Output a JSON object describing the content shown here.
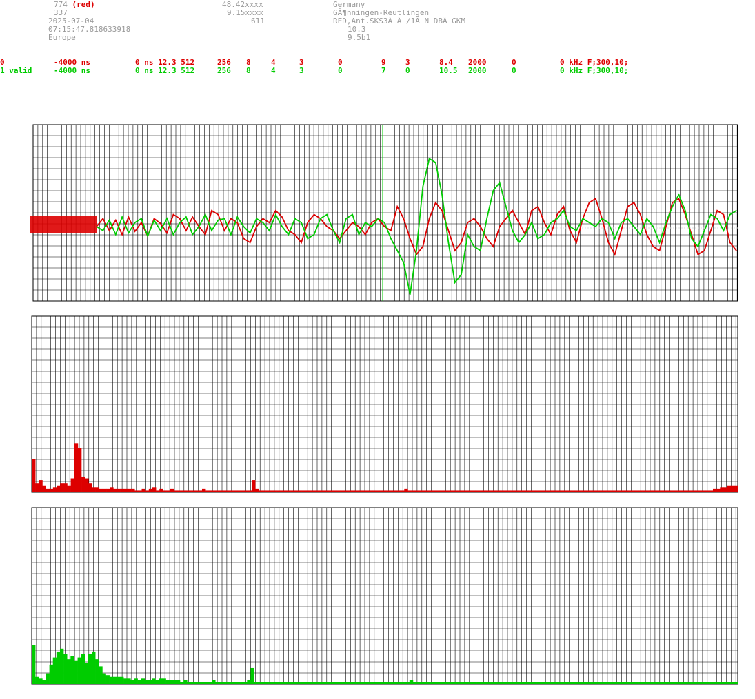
{
  "header": {
    "col1": [
      "774",
      "337",
      "2025-07-04",
      "07:15:47.818633918",
      "Europe"
    ],
    "col1_red_suffix": "(red)",
    "col2": [
      "48.42xxxx",
      "9.15xxxx",
      "611"
    ],
    "col3": [
      "Germany",
      "GÃ¶nningen-Reutlingen",
      "RED,Ant.SKS3Ã Ã /1Ã N DBÃ GKM"
    ],
    "col4": [
      "10.3",
      "9.5b1"
    ]
  },
  "rows": [
    {
      "color": "#dd0000",
      "fields": [
        "0",
        "-4000 ns",
        "0 ns 12.3 512",
        "256",
        "8",
        "4",
        "3",
        "0",
        "9",
        "3",
        "8.4",
        "2000",
        "0",
        "0 kHz F;300,10;"
      ]
    },
    {
      "color": "#00cc00",
      "fields": [
        "1 valid",
        "-4000 ns",
        "0 ns 12.3 512",
        "256",
        "8",
        "4",
        "3",
        "0",
        "7",
        "0",
        "10.5",
        "2000",
        "0",
        "0 kHz F;300,10;"
      ]
    }
  ],
  "chart_data": [
    {
      "type": "line",
      "ylim": [
        -1,
        1
      ],
      "grid": true,
      "series": [
        {
          "color": "#dd0000",
          "values": [
            0.0,
            0.1,
            -0.05,
            0.08,
            -0.1,
            0.12,
            -0.06,
            0.05,
            -0.12,
            0.1,
            0.04,
            -0.08,
            0.15,
            0.1,
            -0.05,
            0.12,
            0.0,
            -0.1,
            0.2,
            0.15,
            -0.05,
            0.1,
            0.05,
            -0.15,
            -0.2,
            0.0,
            0.1,
            0.05,
            0.2,
            0.12,
            -0.05,
            -0.1,
            -0.2,
            0.05,
            0.15,
            0.1,
            0.0,
            -0.05,
            -0.15,
            -0.05,
            0.05,
            0.0,
            -0.1,
            0.05,
            0.1,
            0.0,
            -0.05,
            0.25,
            0.1,
            -0.15,
            -0.35,
            -0.25,
            0.1,
            0.3,
            0.2,
            -0.05,
            -0.3,
            -0.2,
            0.05,
            0.1,
            0.0,
            -0.15,
            -0.25,
            0.0,
            0.1,
            0.2,
            0.05,
            -0.1,
            0.2,
            0.25,
            0.05,
            -0.1,
            0.15,
            0.25,
            -0.05,
            -0.2,
            0.1,
            0.3,
            0.35,
            0.1,
            -0.2,
            -0.35,
            -0.05,
            0.25,
            0.3,
            0.15,
            -0.1,
            -0.25,
            -0.3,
            0.0,
            0.3,
            0.35,
            0.15,
            -0.1,
            -0.35,
            -0.3,
            -0.05,
            0.2,
            0.15,
            -0.2,
            -0.3
          ]
        },
        {
          "color": "#00cc00",
          "values": [
            0.0,
            -0.05,
            0.08,
            -0.1,
            0.12,
            -0.08,
            0.05,
            0.1,
            -0.12,
            0.08,
            -0.05,
            0.1,
            -0.1,
            0.05,
            0.12,
            -0.1,
            0.0,
            0.15,
            -0.05,
            0.08,
            0.1,
            -0.1,
            0.12,
            0.0,
            -0.08,
            0.1,
            0.05,
            -0.05,
            0.15,
            0.0,
            -0.1,
            0.1,
            0.05,
            -0.15,
            -0.1,
            0.1,
            0.15,
            -0.05,
            -0.2,
            0.1,
            0.15,
            -0.1,
            0.05,
            0.0,
            0.1,
            0.05,
            -0.15,
            -0.3,
            -0.45,
            -0.85,
            -0.3,
            0.5,
            0.85,
            0.8,
            0.4,
            -0.2,
            -0.7,
            -0.6,
            -0.1,
            -0.25,
            -0.3,
            0.1,
            0.45,
            0.55,
            0.25,
            -0.05,
            -0.2,
            -0.1,
            0.05,
            -0.15,
            -0.1,
            0.05,
            0.1,
            0.2,
            0.0,
            -0.05,
            0.1,
            0.05,
            0.0,
            0.1,
            0.05,
            -0.15,
            0.05,
            0.1,
            0.0,
            -0.1,
            0.1,
            0.0,
            -0.2,
            0.05,
            0.25,
            0.4,
            0.2,
            -0.15,
            -0.25,
            -0.05,
            0.15,
            0.1,
            -0.05,
            0.15,
            0.2
          ]
        }
      ]
    },
    {
      "type": "bar",
      "color": "#dd0000",
      "ylim": [
        0,
        1
      ],
      "values": [
        0.19,
        0.05,
        0.07,
        0.04,
        0.02,
        0.02,
        0.03,
        0.04,
        0.05,
        0.05,
        0.04,
        0.08,
        0.28,
        0.25,
        0.09,
        0.08,
        0.05,
        0.03,
        0.03,
        0.02,
        0.02,
        0.02,
        0.03,
        0.02,
        0.02,
        0.02,
        0.02,
        0.02,
        0.02,
        0.01,
        0.01,
        0.02,
        0.01,
        0.02,
        0.03,
        0.01,
        0.02,
        0.01,
        0.01,
        0.02,
        0.01,
        0.01,
        0.01,
        0.01,
        0.01,
        0.01,
        0.01,
        0.01,
        0.02,
        0.01,
        0.01,
        0.01,
        0.01,
        0.01,
        0.01,
        0.01,
        0.01,
        0.01,
        0.01,
        0.01,
        0.01,
        0.01,
        0.07,
        0.02,
        0.01,
        0.01,
        0.01,
        0.01,
        0.01,
        0.01,
        0.01,
        0.01,
        0.01,
        0.01,
        0.01,
        0.01,
        0.01,
        0.01,
        0.01,
        0.01,
        0.01,
        0.01,
        0.01,
        0.01,
        0.01,
        0.01,
        0.01,
        0.01,
        0.01,
        0.01,
        0.01,
        0.01,
        0.01,
        0.01,
        0.01,
        0.01,
        0.01,
        0.01,
        0.01,
        0.01,
        0.01,
        0.01,
        0.01,
        0.01,
        0.01,
        0.02,
        0.01,
        0.01,
        0.01,
        0.01,
        0.01,
        0.01,
        0.01,
        0.01,
        0.01,
        0.01,
        0.01,
        0.01,
        0.01,
        0.01,
        0.01,
        0.01,
        0.01,
        0.01,
        0.01,
        0.01,
        0.01,
        0.01,
        0.01,
        0.01,
        0.01,
        0.01,
        0.01,
        0.01,
        0.01,
        0.01,
        0.01,
        0.01,
        0.01,
        0.01,
        0.01,
        0.01,
        0.01,
        0.01,
        0.01,
        0.01,
        0.01,
        0.01,
        0.01,
        0.01,
        0.01,
        0.01,
        0.01,
        0.01,
        0.01,
        0.01,
        0.01,
        0.01,
        0.01,
        0.01,
        0.01,
        0.01,
        0.01,
        0.01,
        0.01,
        0.01,
        0.01,
        0.01,
        0.01,
        0.01,
        0.01,
        0.01,
        0.01,
        0.01,
        0.01,
        0.01,
        0.01,
        0.01,
        0.01,
        0.01,
        0.01,
        0.01,
        0.01,
        0.01,
        0.01,
        0.01,
        0.01,
        0.01,
        0.01,
        0.01,
        0.01,
        0.01,
        0.02,
        0.02,
        0.03,
        0.03,
        0.04,
        0.04,
        0.04
      ]
    },
    {
      "type": "bar",
      "color": "#00cc00",
      "ylim": [
        0,
        1
      ],
      "values": [
        0.22,
        0.04,
        0.03,
        0.02,
        0.06,
        0.11,
        0.15,
        0.18,
        0.2,
        0.17,
        0.14,
        0.16,
        0.13,
        0.15,
        0.17,
        0.12,
        0.17,
        0.18,
        0.14,
        0.1,
        0.06,
        0.05,
        0.04,
        0.04,
        0.04,
        0.04,
        0.03,
        0.03,
        0.02,
        0.03,
        0.02,
        0.03,
        0.02,
        0.02,
        0.03,
        0.02,
        0.03,
        0.03,
        0.02,
        0.02,
        0.02,
        0.02,
        0.01,
        0.02,
        0.01,
        0.01,
        0.01,
        0.01,
        0.01,
        0.01,
        0.01,
        0.02,
        0.01,
        0.01,
        0.01,
        0.01,
        0.01,
        0.01,
        0.01,
        0.01,
        0.01,
        0.02,
        0.09,
        0.01,
        0.01,
        0.01,
        0.01,
        0.01,
        0.01,
        0.01,
        0.01,
        0.01,
        0.01,
        0.01,
        0.01,
        0.01,
        0.01,
        0.01,
        0.01,
        0.01,
        0.01,
        0.01,
        0.01,
        0.01,
        0.01,
        0.01,
        0.01,
        0.01,
        0.01,
        0.01,
        0.01,
        0.01,
        0.01,
        0.01,
        0.01,
        0.01,
        0.01,
        0.01,
        0.01,
        0.01,
        0.01,
        0.01,
        0.01,
        0.01,
        0.01,
        0.01,
        0.01,
        0.02,
        0.01,
        0.01,
        0.01,
        0.01,
        0.01,
        0.01,
        0.01,
        0.01,
        0.01,
        0.01,
        0.01,
        0.01,
        0.01,
        0.01,
        0.01,
        0.01,
        0.01,
        0.01,
        0.01,
        0.01,
        0.01,
        0.01,
        0.01,
        0.01,
        0.01,
        0.01,
        0.01,
        0.01,
        0.01,
        0.01,
        0.01,
        0.01,
        0.01,
        0.01,
        0.01,
        0.01,
        0.01,
        0.01,
        0.01,
        0.01,
        0.01,
        0.01,
        0.01,
        0.01,
        0.01,
        0.01,
        0.01,
        0.01,
        0.01,
        0.01,
        0.01,
        0.01,
        0.01,
        0.01,
        0.01,
        0.01,
        0.01,
        0.01,
        0.01,
        0.01,
        0.01,
        0.01,
        0.01,
        0.01,
        0.01,
        0.01,
        0.01,
        0.01,
        0.01,
        0.01,
        0.01,
        0.01,
        0.01,
        0.01,
        0.01,
        0.01,
        0.01,
        0.01,
        0.01,
        0.01,
        0.01,
        0.01,
        0.01,
        0.01,
        0.01,
        0.01,
        0.01,
        0.01,
        0.01,
        0.01,
        0.01,
        0.01
      ]
    }
  ]
}
